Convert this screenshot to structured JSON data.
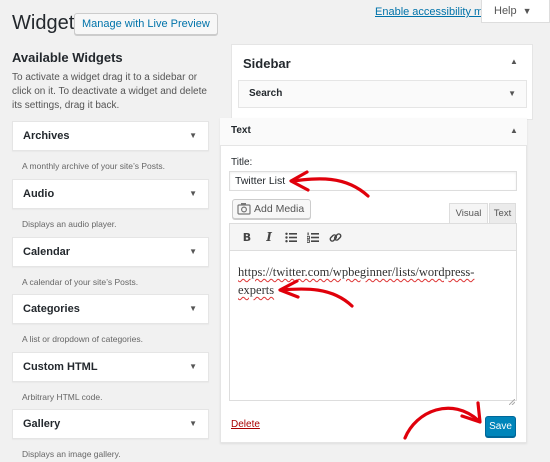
{
  "header": {
    "title": "Widgets",
    "preview_button": "Manage with Live Preview",
    "accessibility_link": "Enable accessibility mode",
    "help_tab": "Help"
  },
  "available": {
    "title": "Available Widgets",
    "description": "To activate a widget drag it to a sidebar or click on it. To deactivate a widget and delete its settings, drag it back.",
    "widgets": [
      {
        "name": "Archives",
        "desc": "A monthly archive of your site’s Posts."
      },
      {
        "name": "Audio",
        "desc": "Displays an audio player."
      },
      {
        "name": "Calendar",
        "desc": "A calendar of your site’s Posts."
      },
      {
        "name": "Categories",
        "desc": "A list or dropdown of categories."
      },
      {
        "name": "Custom HTML",
        "desc": "Arbitrary HTML code."
      },
      {
        "name": "Gallery",
        "desc": "Displays an image gallery."
      }
    ]
  },
  "sidebar": {
    "title": "Sidebar",
    "widgets": [
      {
        "name": "Search"
      }
    ]
  },
  "text_widget": {
    "header": "Text",
    "title_label": "Title:",
    "title_value": "Twitter List",
    "add_media": "Add Media",
    "tab_visual": "Visual",
    "tab_text": "Text",
    "content_line1": "https://twitter.com/wpbeginner/lists/wordpress-",
    "content_line2": "experts",
    "delete_label": "Delete",
    "save_label": "Save"
  },
  "icons": {
    "dropdown": "caret-down-icon",
    "collapse": "caret-up-icon",
    "media": "camera-music-icon",
    "bold": "bold-icon",
    "italic": "italic-icon",
    "bullet_list": "bullet-list-icon",
    "numbered_list": "numbered-list-icon",
    "link": "link-icon"
  },
  "colors": {
    "primary": "#0085ba",
    "link": "#0073aa",
    "delete": "#a00000",
    "annotation": "#e0000b"
  }
}
